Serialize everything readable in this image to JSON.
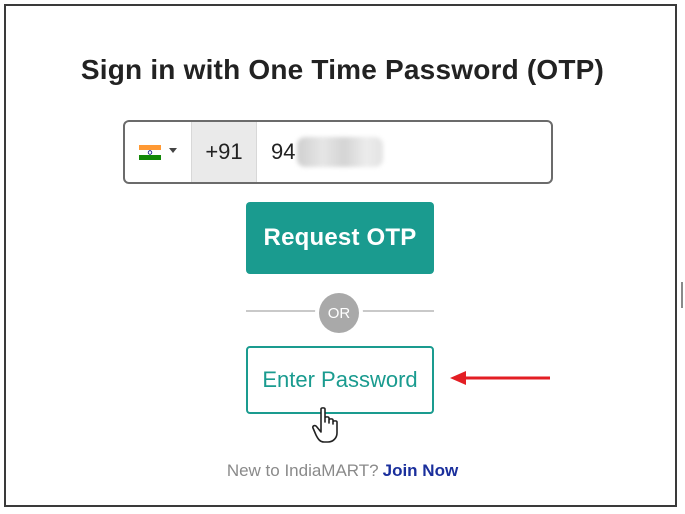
{
  "heading": "Sign in with One Time Password (OTP)",
  "phone": {
    "country_icon": "india-flag-icon",
    "dial_code": "+91",
    "value_visible": "94"
  },
  "buttons": {
    "request_otp": "Request OTP",
    "enter_password": "Enter Password"
  },
  "divider": {
    "label": "OR"
  },
  "footer": {
    "prompt": "New to IndiaMART?",
    "link": "Join Now"
  },
  "colors": {
    "primary": "#1a9b8f",
    "link": "#1a2f9c",
    "annotation_arrow": "#e31e24"
  }
}
